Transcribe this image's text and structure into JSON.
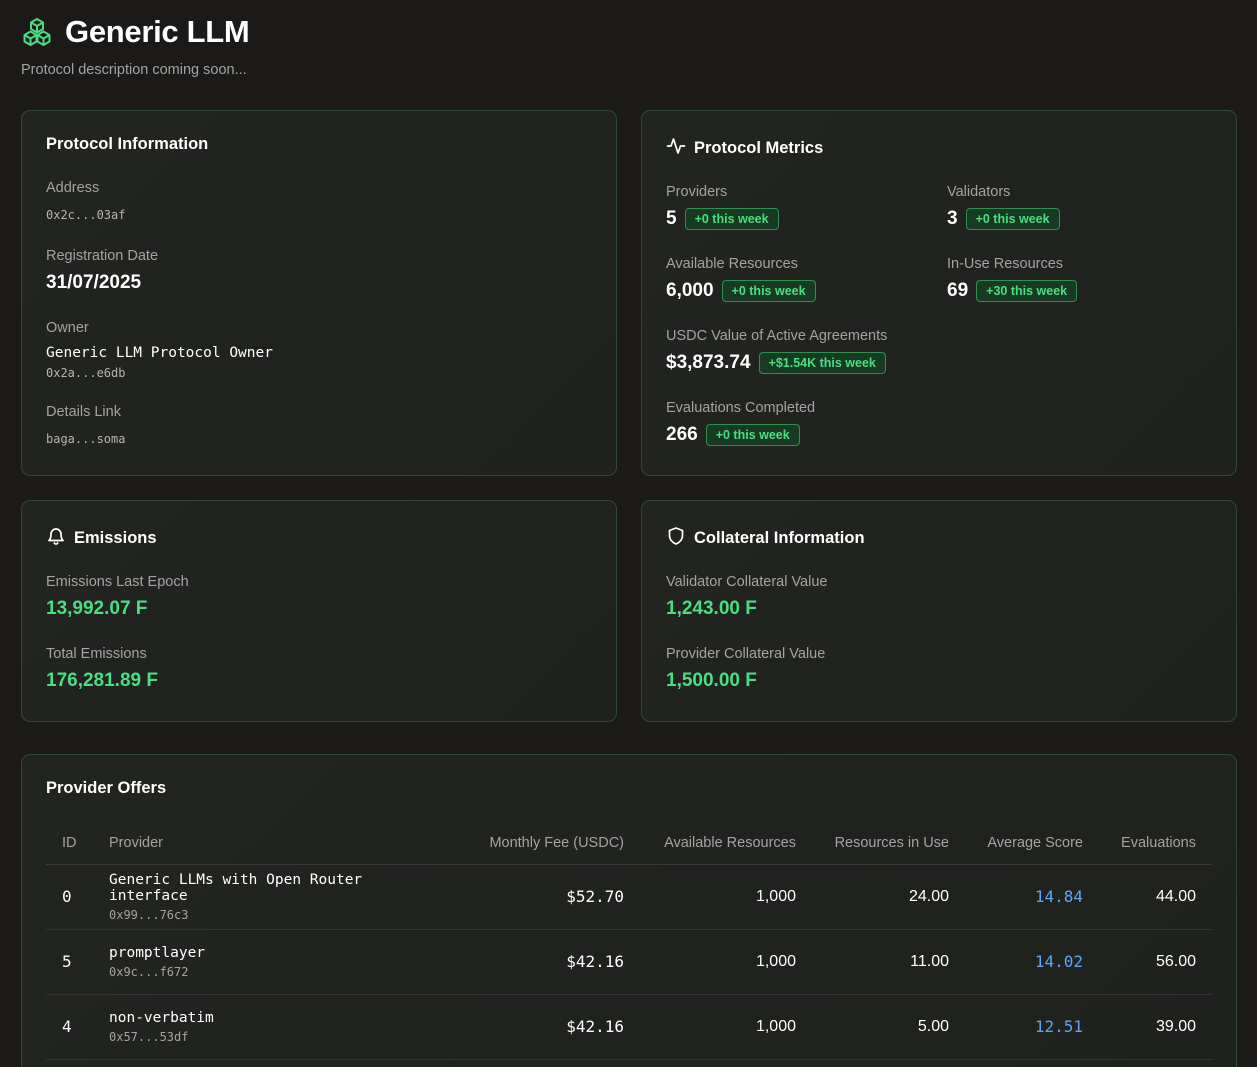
{
  "header": {
    "title": "Generic LLM",
    "subtitle": "Protocol description coming soon..."
  },
  "info": {
    "title": "Protocol Information",
    "address_label": "Address",
    "address_value": "0x2c...03af",
    "reg_label": "Registration Date",
    "reg_value": "31/07/2025",
    "owner_label": "Owner",
    "owner_name": "Generic LLM Protocol Owner",
    "owner_address": "0x2a...e6db",
    "details_label": "Details Link",
    "details_value": "baga...soma"
  },
  "metrics": {
    "title": "Protocol Metrics",
    "providers": {
      "label": "Providers",
      "value": "5",
      "badge": "+0 this week"
    },
    "validators": {
      "label": "Validators",
      "value": "3",
      "badge": "+0 this week"
    },
    "available": {
      "label": "Available Resources",
      "value": "6,000",
      "badge": "+0 this week"
    },
    "inuse": {
      "label": "In-Use Resources",
      "value": "69",
      "badge": "+30 this week"
    },
    "usdc": {
      "label": "USDC Value of Active Agreements",
      "value": "$3,873.74",
      "badge": "+$1.54K this week"
    },
    "evaluations": {
      "label": "Evaluations Completed",
      "value": "266",
      "badge": "+0 this week"
    }
  },
  "emissions": {
    "title": "Emissions",
    "last_label": "Emissions Last Epoch",
    "last_value": "13,992.07 F",
    "total_label": "Total Emissions",
    "total_value": "176,281.89 F"
  },
  "collateral": {
    "title": "Collateral Information",
    "validator_label": "Validator Collateral Value",
    "validator_value": "1,243.00 F",
    "provider_label": "Provider Collateral Value",
    "provider_value": "1,500.00 F"
  },
  "offers": {
    "title": "Provider Offers",
    "columns": [
      "ID",
      "Provider",
      "Monthly Fee (USDC)",
      "Available Resources",
      "Resources in Use",
      "Average Score",
      "Evaluations"
    ],
    "rows": [
      {
        "id": "0",
        "name": "Generic LLMs with Open Router interface",
        "address": "0x99...76c3",
        "fee": "$52.70",
        "available": "1,000",
        "in_use": "24.00",
        "score": "14.84",
        "evaluations": "44.00"
      },
      {
        "id": "5",
        "name": "promptlayer",
        "address": "0x9c...f672",
        "fee": "$42.16",
        "available": "1,000",
        "in_use": "11.00",
        "score": "14.02",
        "evaluations": "56.00"
      },
      {
        "id": "4",
        "name": "non-verbatim",
        "address": "0x57...53df",
        "fee": "$42.16",
        "available": "1,000",
        "in_use": "5.00",
        "score": "12.51",
        "evaluations": "39.00"
      }
    ]
  },
  "colors": {
    "accent_green": "#4ade80",
    "score_blue": "#60a5fa",
    "background": "#1c1a18"
  }
}
